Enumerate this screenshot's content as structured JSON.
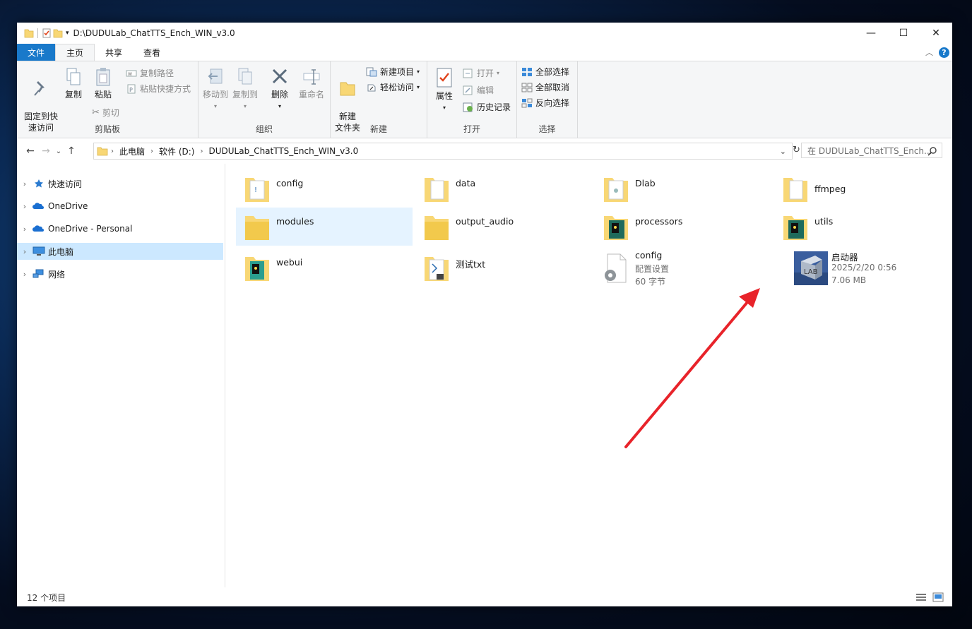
{
  "window": {
    "title": "D:\\DUDULab_ChatTTS_Ench_WIN_v3.0",
    "controls": [
      "—",
      "☐",
      "✕"
    ]
  },
  "tabs": [
    {
      "label": "文件"
    },
    {
      "label": "主页"
    },
    {
      "label": "共享"
    },
    {
      "label": "查看"
    }
  ],
  "ribbon": {
    "clipboard": {
      "pin_label": "固定到快\n速访问",
      "copy_label": "复制",
      "paste_label": "粘贴",
      "copy_path_label": "复制路径",
      "paste_shortcut_label": "粘贴快捷方式",
      "cut_label": "剪切",
      "group_label": "剪贴板"
    },
    "organize": {
      "move_to_label": "移动到",
      "copy_to_label": "复制到",
      "delete_label": "删除",
      "rename_label": "重命名",
      "group_label": "组织"
    },
    "new": {
      "new_folder_label": "新建\n文件夹",
      "new_item_label": "新建项目",
      "easy_access_label": "轻松访问",
      "group_label": "新建"
    },
    "open": {
      "properties_label": "属性",
      "open_label": "打开",
      "edit_label": "编辑",
      "history_label": "历史记录",
      "group_label": "打开"
    },
    "select": {
      "select_all_label": "全部选择",
      "select_none_label": "全部取消",
      "invert_label": "反向选择",
      "group_label": "选择"
    }
  },
  "address": {
    "crumbs": [
      "此电脑",
      "软件 (D:)",
      "DUDULab_ChatTTS_Ench_WIN_v3.0"
    ],
    "search_placeholder": "在 DUDULab_ChatTTS_Ench..."
  },
  "nav": {
    "items": [
      {
        "label": "快速访问",
        "icon": "star-icon"
      },
      {
        "label": "OneDrive",
        "icon": "cloud-icon"
      },
      {
        "label": "OneDrive - Personal",
        "icon": "cloud-icon"
      },
      {
        "label": "此电脑",
        "icon": "computer-icon"
      },
      {
        "label": "网络",
        "icon": "network-icon"
      }
    ]
  },
  "files": [
    {
      "name": "config",
      "type": "folder"
    },
    {
      "name": "data",
      "type": "folder"
    },
    {
      "name": "Dlab",
      "type": "folder"
    },
    {
      "name": "ffmpeg",
      "type": "folder"
    },
    {
      "name": "modules",
      "type": "folder"
    },
    {
      "name": "output_audio",
      "type": "folder"
    },
    {
      "name": "processors",
      "type": "folder"
    },
    {
      "name": "utils",
      "type": "folder"
    },
    {
      "name": "webui",
      "type": "folder"
    },
    {
      "name": "测试txt",
      "type": "folder"
    },
    {
      "name": "config",
      "type": "settings",
      "line2": "配置设置",
      "line3": "60 字节"
    },
    {
      "name": "启动器",
      "type": "exe",
      "line2": "2025/2/20 0:56",
      "line3": "7.06 MB"
    }
  ],
  "status": {
    "count": "12 个项目"
  },
  "colors": {
    "accent": "#1979ca",
    "selection": "#cce8ff",
    "hover": "#e5f3ff",
    "folder": "#f8d775",
    "arrow": "#e8232a"
  }
}
